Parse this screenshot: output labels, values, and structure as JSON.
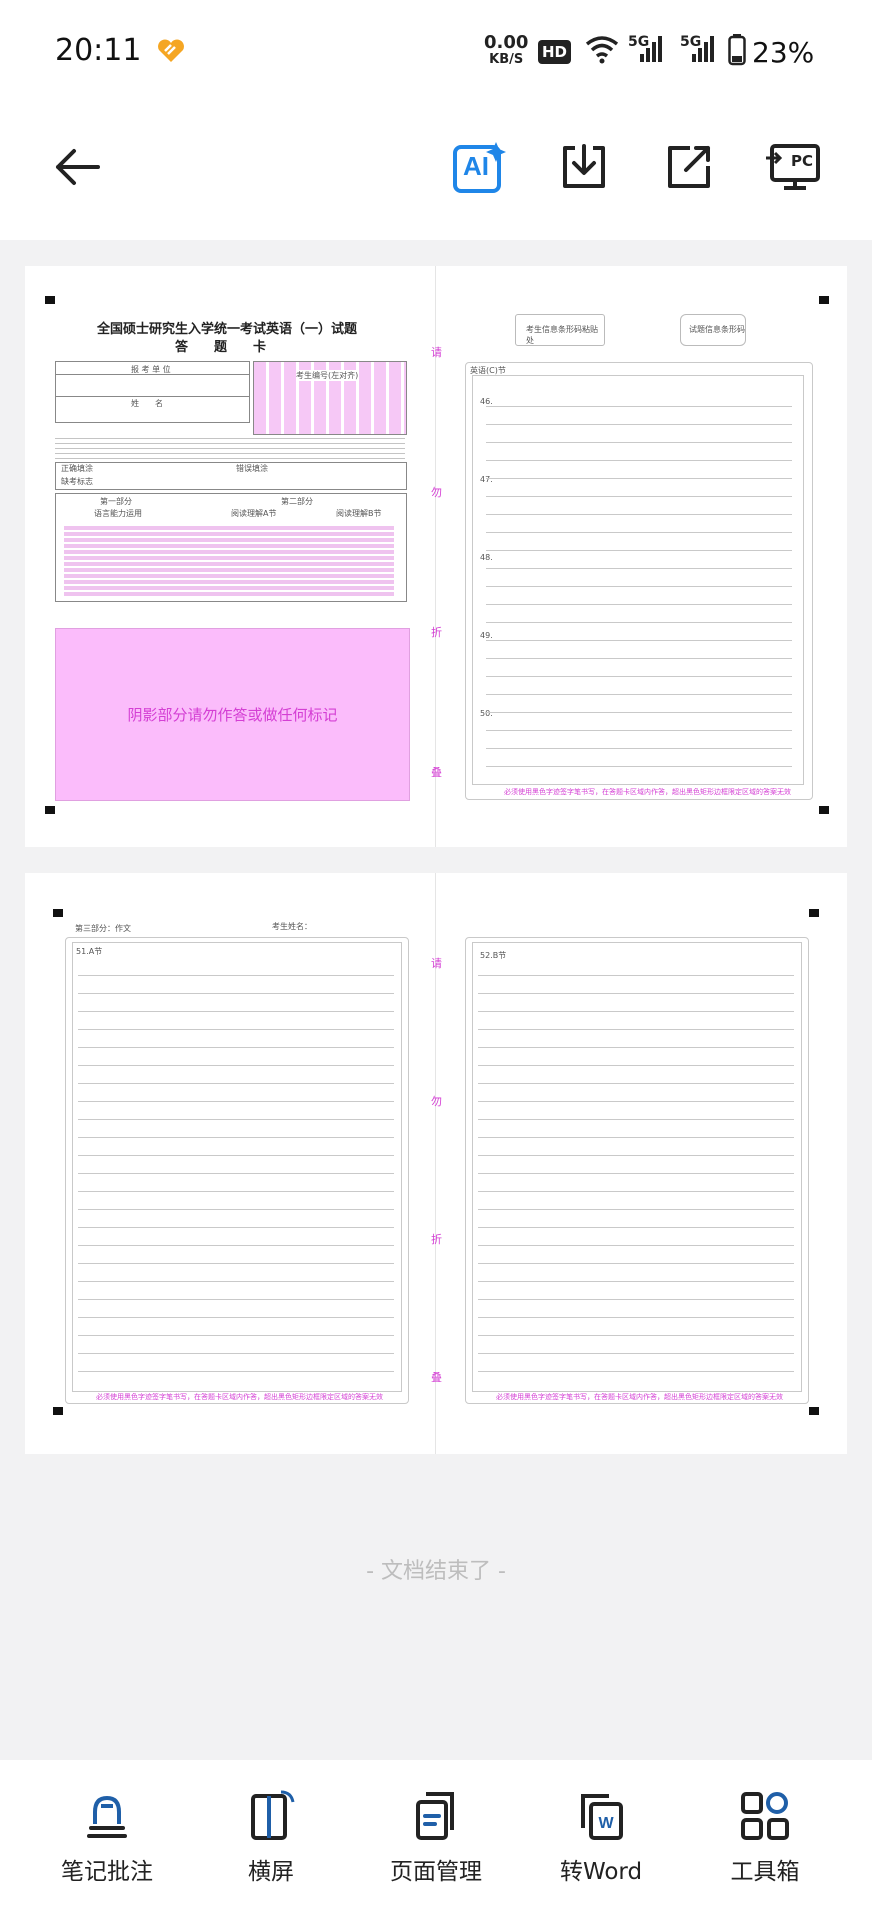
{
  "status": {
    "time": "20:11",
    "net_speed": "0.00",
    "net_unit": "KB/S",
    "hd": "HD",
    "signal1": "5G",
    "signal2": "5G",
    "battery": "23%"
  },
  "toolbar": {
    "ai_label": "AI",
    "pc_label": "PC"
  },
  "doc": {
    "page1_title": "全国硕士研究生入学统一考试英语（一）试题",
    "page1_subtitle": "答　　题　　卡",
    "label_unit": "报 考 单 位",
    "label_name": "姓　　名",
    "label_id": "考生编号(左对齐)",
    "label_correct": "正确填涂",
    "label_wrong": "错误填涂",
    "label_miss": "缺考标志",
    "part1": "第一部分",
    "part1_sub": "语言能力运用",
    "part2": "第二部分",
    "part2_a": "阅读理解A节",
    "part2_b": "阅读理解B节",
    "shaded_notice": "阴影部分请勿作答或做任何标记",
    "barcode1": "考生信息条形码粘贴处",
    "barcode2": "试题信息条形码",
    "section_c": "英语(C)节",
    "q46": "46.",
    "q47": "47.",
    "q48": "48.",
    "q49": "49.",
    "q50": "50.",
    "warn": "必须使用黑色字迹签字笔书写，在答题卡区域内作答，超出黑色矩形边框限定区域的答案无效",
    "side1": "请",
    "side2": "勿",
    "side3": "折",
    "side4": "叠",
    "page2_part": "第三部分：作文",
    "page2_name": "考生姓名：",
    "q51": "51.A节",
    "q52": "52.B节",
    "end": "- 文档结束了 -"
  },
  "nav": {
    "notes": "笔记批注",
    "landscape": "横屏",
    "pages": "页面管理",
    "word": "转Word",
    "tools": "工具箱"
  }
}
